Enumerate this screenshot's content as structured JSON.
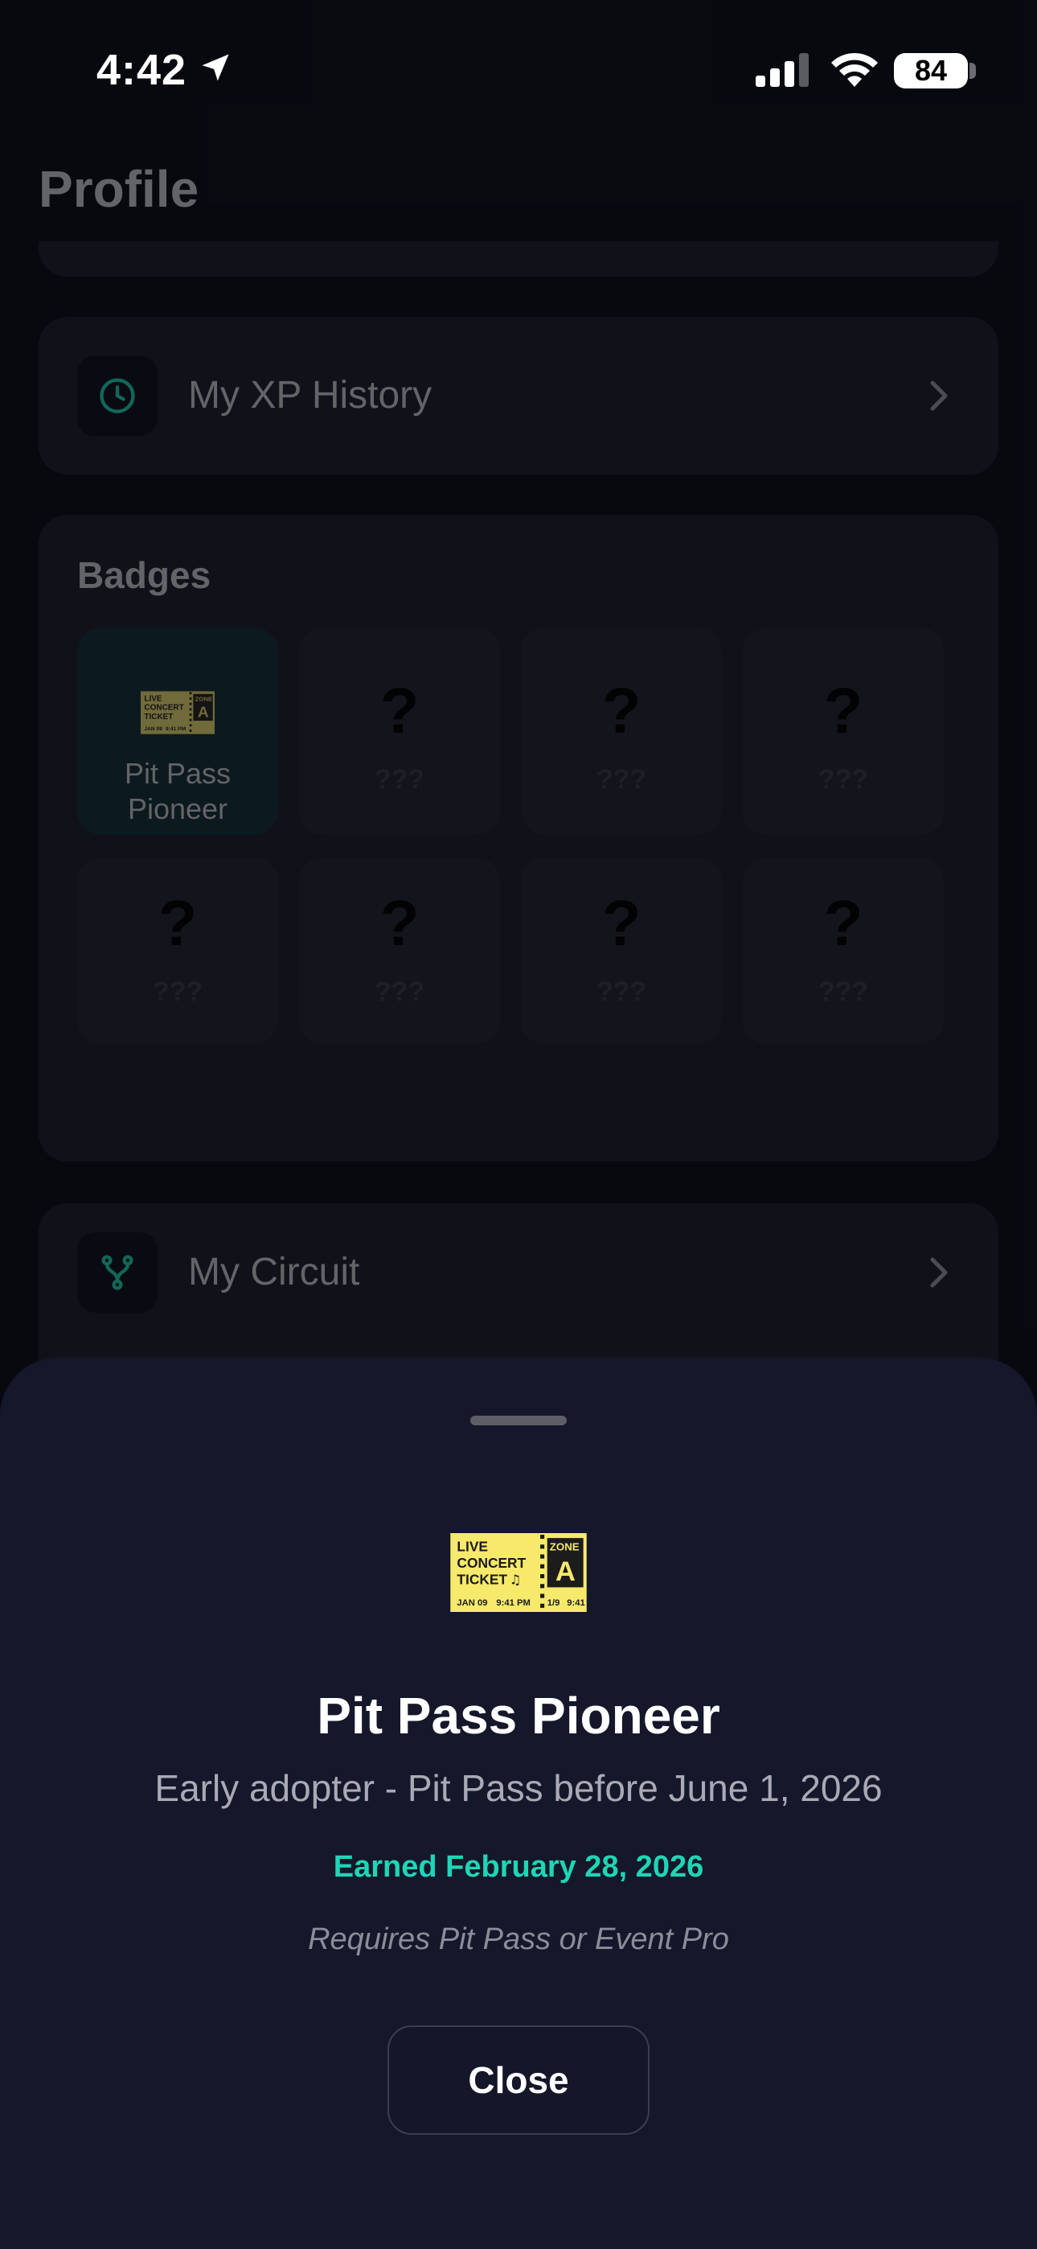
{
  "status_bar": {
    "time": "4:42",
    "battery": "84"
  },
  "profile": {
    "title": "Profile",
    "xp_history_label": "My XP History",
    "badges_title": "Badges",
    "circuit_label": "My Circuit"
  },
  "badges": [
    {
      "name": "Pit Pass Pioneer",
      "earned": true
    },
    {
      "name": "???",
      "earned": false
    },
    {
      "name": "???",
      "earned": false
    },
    {
      "name": "???",
      "earned": false
    },
    {
      "name": "???",
      "earned": false
    },
    {
      "name": "???",
      "earned": false
    },
    {
      "name": "???",
      "earned": false
    },
    {
      "name": "???",
      "earned": false
    }
  ],
  "badge_placeholder_glyph": "?",
  "ticket": {
    "line1": "LIVE",
    "line2": "CONCERT",
    "line3": "TICKET",
    "zone_label": "ZONE",
    "zone": "A",
    "date": "JAN 09",
    "time": "9:41 PM",
    "stub_date": "1/9",
    "stub_time": "9:41",
    "note_glyph": "♫"
  },
  "sheet": {
    "title": "Pit Pass Pioneer",
    "description": "Early adopter - Pit Pass before June 1, 2026",
    "earned": "Earned February 28, 2026",
    "requirement": "Requires Pit Pass or Event Pro",
    "close_label": "Close"
  },
  "colors": {
    "accent": "#1ed6b6",
    "ticket_yellow": "#f7e96b",
    "sheet_bg": "#15172a",
    "card_bg": "#181923"
  }
}
